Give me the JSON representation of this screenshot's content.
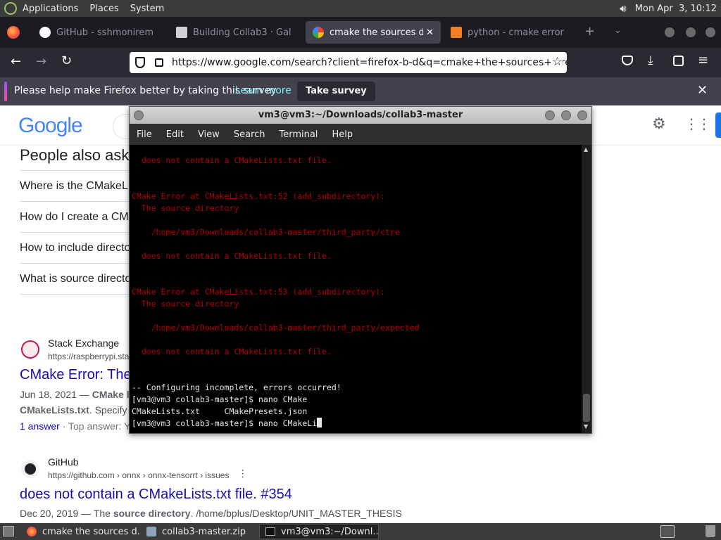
{
  "topbar": {
    "menus": [
      "Applications",
      "Places",
      "System"
    ],
    "clock": "Mon Apr  3, 10:12"
  },
  "browser": {
    "tabs": [
      {
        "label": "GitHub - sshmonirem"
      },
      {
        "label": "Building Collab3 · Gal"
      },
      {
        "label": "cmake the sources dire"
      },
      {
        "label": "python - cmake error"
      }
    ],
    "url": "https://www.google.com/search?client=firefox-b-d&q=cmake+the+sources+directory+c",
    "survey": {
      "text": "Please help make Firefox better by taking this survey",
      "link": "Learn more",
      "button": "Take survey"
    }
  },
  "google": {
    "logo": "Google",
    "paa_title": "People also ask",
    "questions": [
      "Where is the CMakeL",
      "How do I create a CM",
      "How to include directo",
      "What is source directo"
    ],
    "result1": {
      "site": "Stack Exchange",
      "url": "https://raspberrypi.sta",
      "title": "CMake Error: The",
      "date": "Jun 18, 2021 — ",
      "snippet_bold": "CMake l",
      "snippet2_bold": "CMakeLists.txt",
      "snippet2": ". Specify",
      "answer_link": "1 answer",
      "answer_rest": " · Top answer: Y"
    },
    "result2": {
      "site": "GitHub",
      "url": "https://github.com › onnx › onnx-tensorrt › issues",
      "title": "does not contain a CMakeLists.txt file. #354",
      "date": "Dec 20, 2019 — ",
      "snippet_a": "The ",
      "snippet_bold": "source directory",
      "snippet_b": ". /home/bplus/Desktop/UNIT_MASTER_THESIS"
    }
  },
  "terminal": {
    "title": "vm3@vm3:~/Downloads/collab3-master",
    "menu": [
      "File",
      "Edit",
      "View",
      "Search",
      "Terminal",
      "Help"
    ],
    "lines": [
      "  does not contain a CMakeLists.txt file.",
      "",
      "",
      "CMake Error at CMakeLists.txt:52 (add_subdirectory):",
      "  The source directory",
      "",
      "    /home/vm3/Downloads/collab3-master/third_party/ctre",
      "",
      "  does not contain a CMakeLists.txt file.",
      "",
      "",
      "CMake Error at CMakeLists.txt:53 (add_subdirectory):",
      "  The source directory",
      "",
      "    /home/vm3/Downloads/collab3-master/third_party/expected",
      "",
      "  does not contain a CMakeLists.txt file.",
      "",
      "",
      "-- Configuring incomplete, errors occurred!",
      "[vm3@vm3 collab3-master]$ nano CMake",
      "CMakeLists.txt     CMakePresets.json",
      "[vm3@vm3 collab3-master]$ nano CMakeLi"
    ]
  },
  "taskbar": {
    "items": [
      "cmake the sources d...",
      "collab3-master.zip",
      "vm3@vm3:~/Downl..."
    ]
  }
}
